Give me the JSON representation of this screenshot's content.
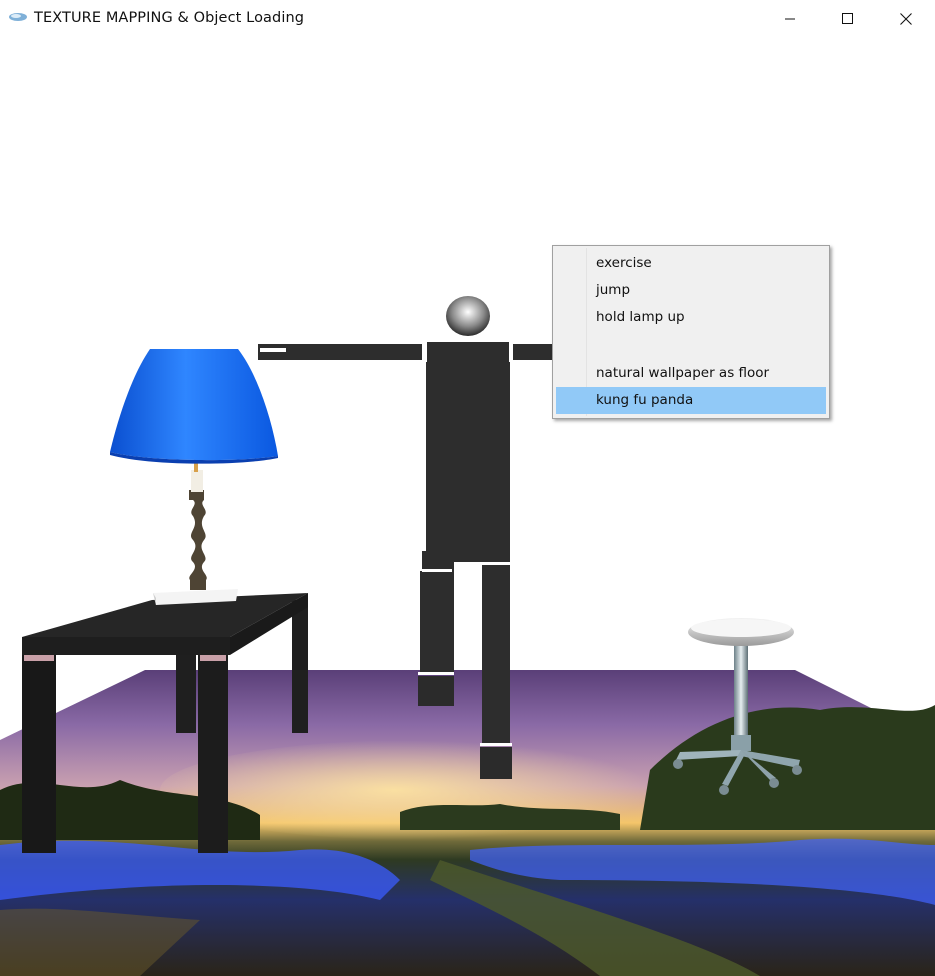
{
  "window": {
    "title": "TEXTURE MAPPING & Object Loading",
    "controls": [
      "minimize",
      "maximize",
      "close"
    ]
  },
  "scene": {
    "objects": [
      "table-lamp",
      "table",
      "humanoid-figure",
      "bar-stool",
      "textured-floor"
    ],
    "floor_texture": "natural wallpaper",
    "colors": {
      "lamp_shade": "#1a6ff0",
      "figure": "#2d2d2d",
      "table": "#222222",
      "sky_top": "#6a4a8a",
      "horizon_glow": "#f4c56a",
      "floor_lights": "#3b5cff"
    }
  },
  "context_menu": {
    "items": [
      {
        "label": "exercise",
        "selected": false
      },
      {
        "label": "jump",
        "selected": false
      },
      {
        "label": "hold lamp up",
        "selected": false
      },
      {
        "label": "",
        "selected": false
      },
      {
        "label": "natural wallpaper as floor",
        "selected": false
      },
      {
        "label": "kung fu panda",
        "selected": true
      }
    ],
    "highlight_color": "#91c9f7"
  }
}
